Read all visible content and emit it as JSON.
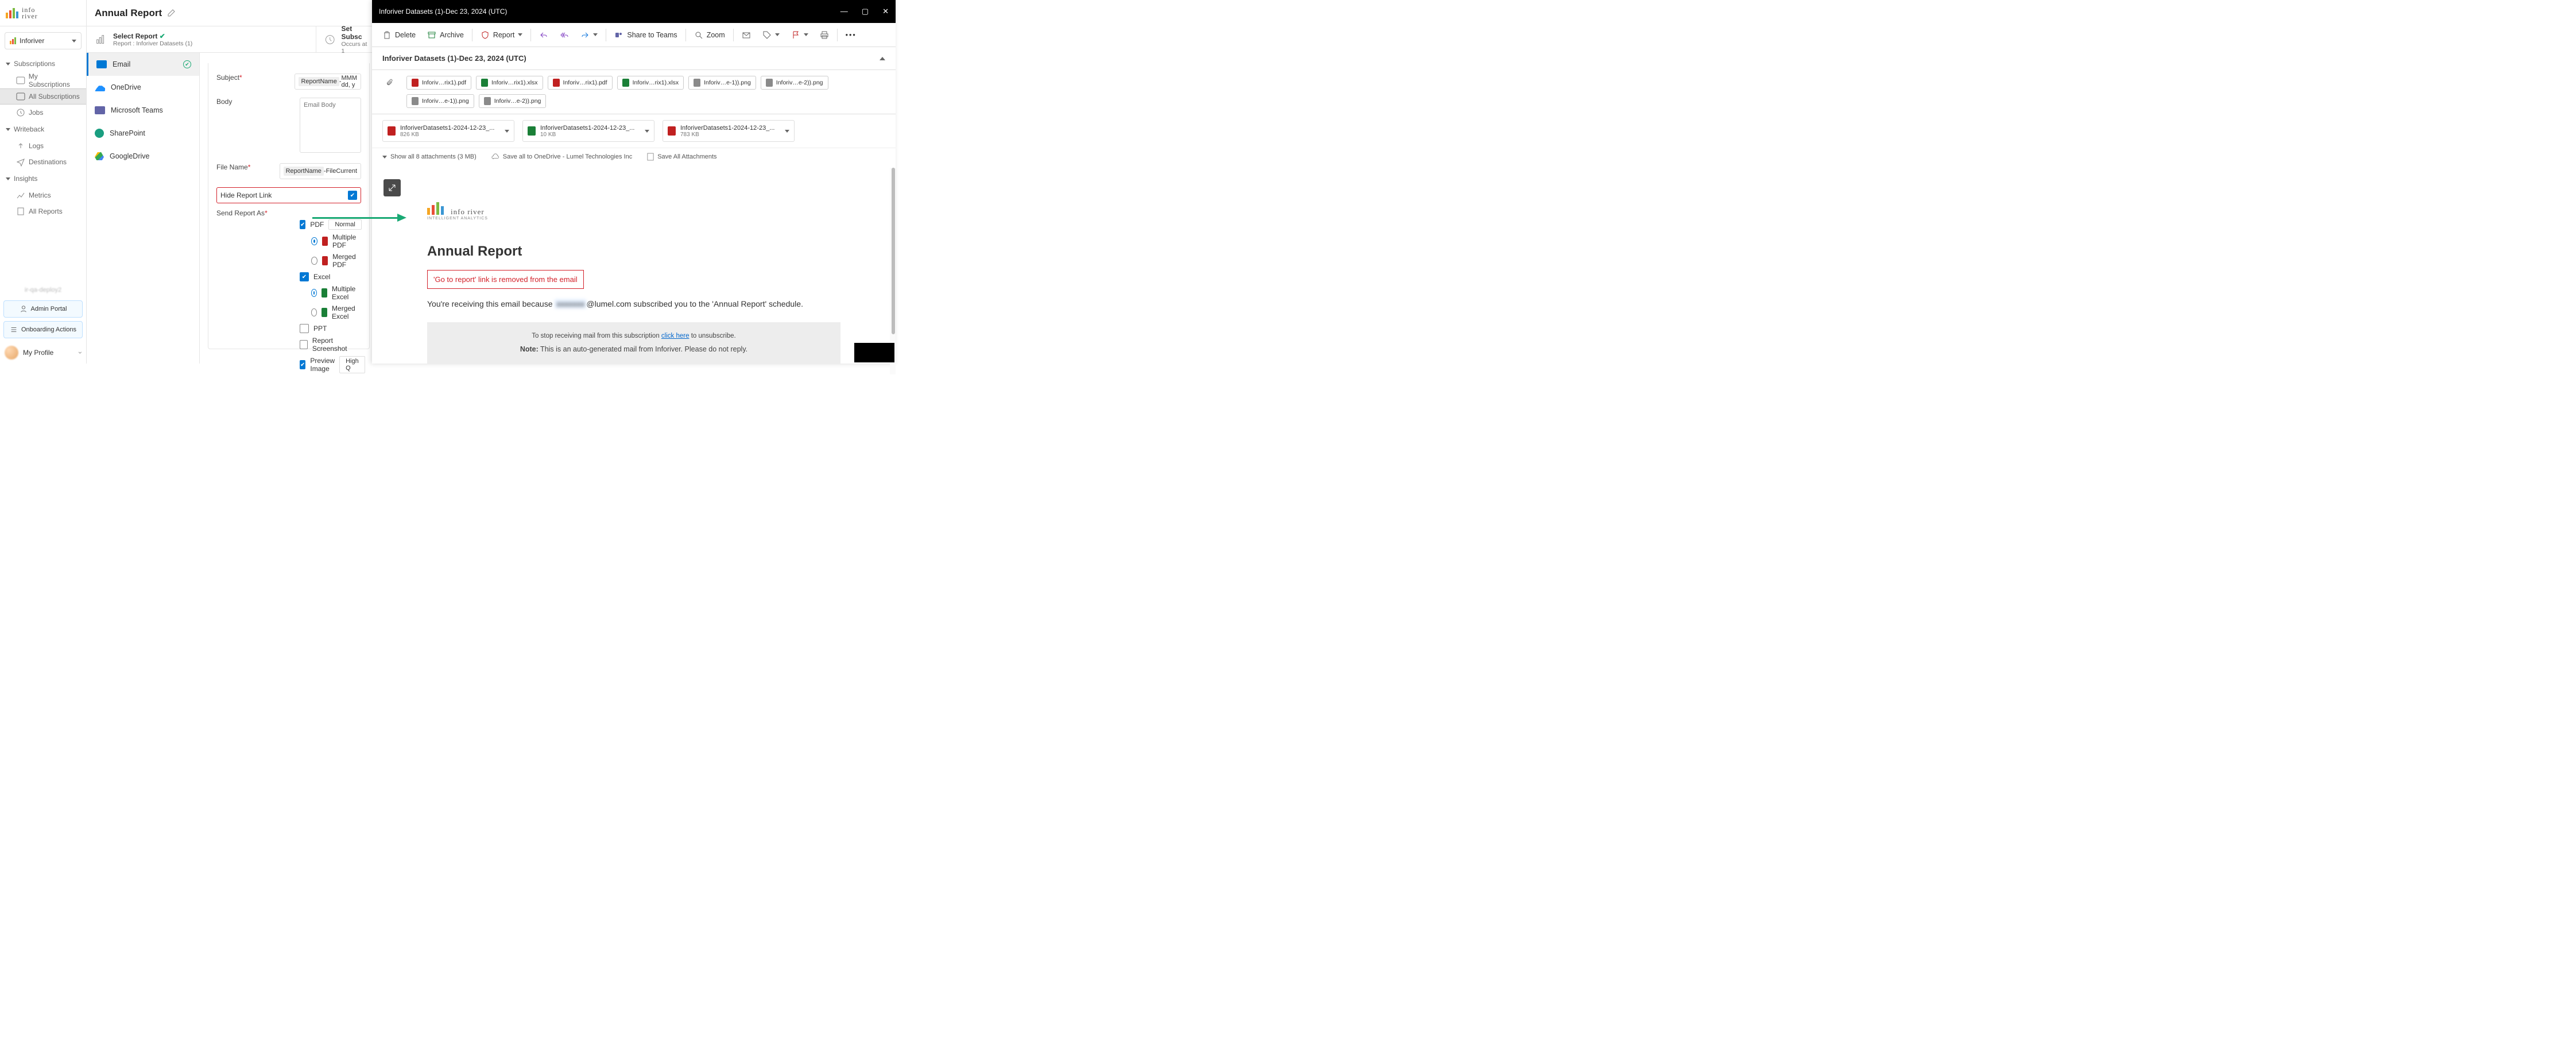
{
  "brand": {
    "name": "info\nriver"
  },
  "workspace": {
    "name": "Inforiver"
  },
  "nav": {
    "subscriptions": {
      "title": "Subscriptions",
      "my": "My Subscriptions",
      "all": "All Subscriptions",
      "jobs": "Jobs"
    },
    "writeback": {
      "title": "Writeback",
      "logs": "Logs",
      "dest": "Destinations"
    },
    "insights": {
      "title": "Insights",
      "metrics": "Metrics",
      "allreports": "All Reports"
    }
  },
  "bottom": {
    "deploy": "ir-qa-deploy2",
    "admin": "Admin Portal",
    "onboard": "Onboarding Actions",
    "profile": "My Profile"
  },
  "header": {
    "title": "Annual Report"
  },
  "wizard": {
    "step1": {
      "title": "Select Report",
      "sub": "Report : Inforiver Datasets (1)"
    },
    "step2": {
      "title": "Set Subsc",
      "sub": "Occurs at 1"
    }
  },
  "providers": {
    "email": "Email",
    "onedrive": "OneDrive",
    "teams": "Microsoft Teams",
    "sp": "SharePoint",
    "gd": "GoogleDrive"
  },
  "form": {
    "subject_label": "Subject",
    "subject_token": "ReportName",
    "subject_sep": " - ",
    "subject_tail": "MMM dd, y",
    "body_label": "Body",
    "body_placeholder": "Email Body",
    "filename_label": "File Name",
    "filename_token": "ReportName",
    "filename_sep": " - ",
    "filename_tail": "FileCurrent",
    "hide_link": "Hide Report Link",
    "send_as": "Send Report As",
    "pdf": "PDF",
    "normal": "Normal",
    "mult_pdf": "Multiple PDF",
    "merge_pdf": "Merged PDF",
    "excel": "Excel",
    "mult_excel": "Multiple Excel",
    "merge_excel": "Merged Excel",
    "ppt": "PPT",
    "screenshot": "Report Screenshot",
    "preview": "Preview Image",
    "high": "High Q"
  },
  "outlook": {
    "title": "Inforiver Datasets (1)-Dec 23, 2024 (UTC)",
    "tb": {
      "delete": "Delete",
      "archive": "Archive",
      "report": "Report",
      "share": "Share to Teams",
      "zoom": "Zoom"
    },
    "collapse_title": "Inforiver Datasets (1)-Dec 23, 2024 (UTC)",
    "chips": [
      "Inforiv…rix1).pdf",
      "Inforiv…rix1).xlsx",
      "Inforiv…rix1).pdf",
      "Inforiv…rix1).xlsx",
      "Inforiv…e-1)).png",
      "Inforiv…e-2)).png",
      "Inforiv…e-1)).png",
      "Inforiv…e-2)).png"
    ],
    "big": [
      {
        "fn": "InforiverDatasets1-2024-12-23_...",
        "sz": "826 KB"
      },
      {
        "fn": "InforiverDatasets1-2024-12-23_...",
        "sz": "10 KB"
      },
      {
        "fn": "InforiverDatasets1-2024-12-23_...",
        "sz": "783 KB"
      }
    ],
    "actions": {
      "showall": "Show all 8 attachments (3 MB)",
      "saveod": "Save all to OneDrive - Lumel Technologies Inc",
      "saveall": "Save All Attachments"
    },
    "email": {
      "logo_tag": "INTELLIGENT ANALYTICS",
      "h1": "Annual Report",
      "removed": "'Go to report' link is removed from the email",
      "p_pre": "You're receiving this email because ",
      "masked": "xxxxxxx",
      "domain": "@lumel.com",
      "p_post": " subscribed you to the 'Annual Report' schedule.",
      "foot1_pre": "To stop receiving mail from this subscription ",
      "foot1_link": "click here",
      "foot1_post": " to unsubscribe.",
      "note_lbl": "Note:",
      "note_txt": " This is an auto-generated mail from Inforiver. Please do not reply."
    }
  }
}
